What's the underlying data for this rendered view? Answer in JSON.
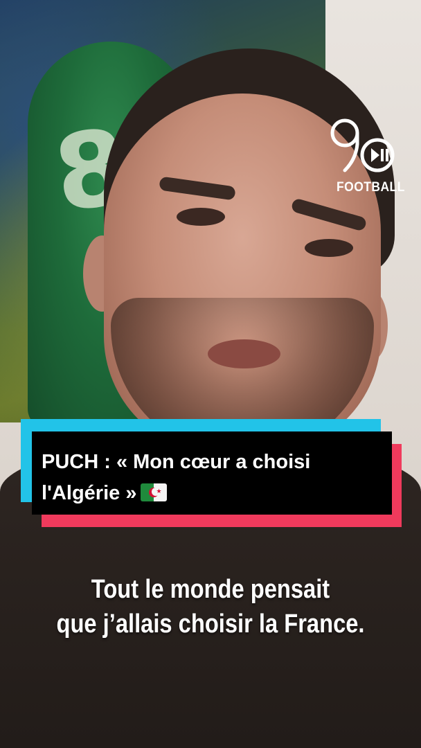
{
  "brand": {
    "logo_text": "FOOTBALL",
    "logo_icon": "90min-play-pause-logo",
    "colors": {
      "cyan": "#22c3e8",
      "pink": "#f03a5c",
      "title_bg": "#000000"
    }
  },
  "title": {
    "line1": "PUCH : « Mon cœur a choisi",
    "line2": "l'Algérie »",
    "flag_icon": "algeria-flag"
  },
  "subtitle": {
    "line1": "Tout le monde pensait",
    "line2": "que j’allais choisir la France."
  },
  "background": {
    "poster_jersey_number": "8"
  }
}
